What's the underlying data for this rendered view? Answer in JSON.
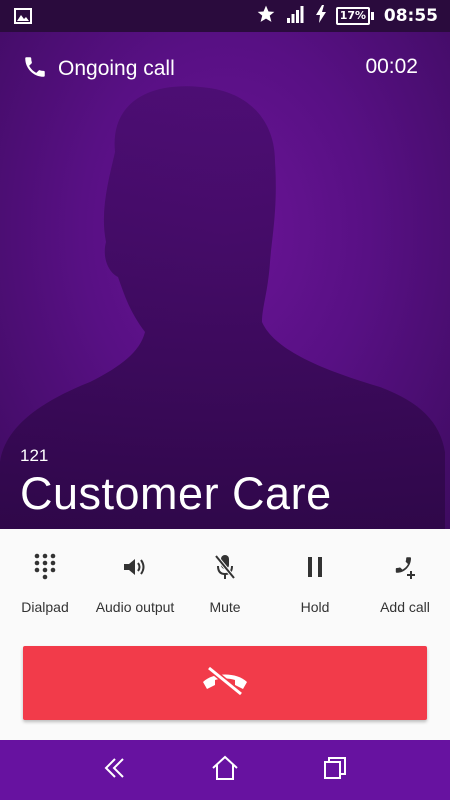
{
  "status_bar": {
    "time": "08:55",
    "battery_percent": "17%",
    "icons": [
      "image-notification-icon",
      "star-icon",
      "signal-icon",
      "charging-icon",
      "battery-icon"
    ]
  },
  "call": {
    "status": "Ongoing call",
    "timer": "00:02",
    "caller_number": "121",
    "caller_name": "Customer Care"
  },
  "actions": [
    {
      "label": "Dialpad",
      "icon": "dialpad-icon"
    },
    {
      "label": "Audio output",
      "icon": "speaker-icon"
    },
    {
      "label": "Mute",
      "icon": "mic-off-icon"
    },
    {
      "label": "Hold",
      "icon": "pause-icon"
    },
    {
      "label": "Add call",
      "icon": "add-call-icon"
    }
  ],
  "end_call": {
    "icon": "end-call-icon",
    "color": "#f23b4a"
  },
  "nav": [
    "back-icon",
    "home-icon",
    "recents-icon"
  ],
  "colors": {
    "accent": "#6712a0",
    "hero": "#581084",
    "end_call": "#f23b4a"
  }
}
